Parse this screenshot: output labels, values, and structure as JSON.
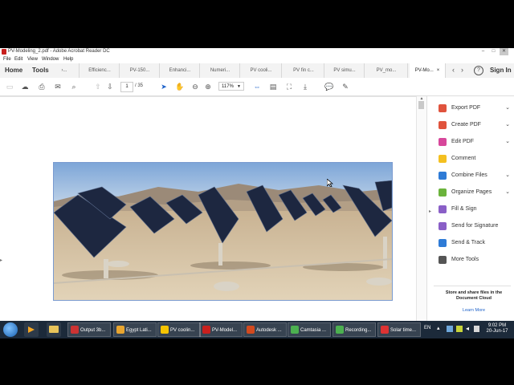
{
  "window": {
    "title": "PV-Modeling_2.pdf - Adobe Acrobat Reader DC",
    "controls": [
      "–",
      "□",
      "✕"
    ]
  },
  "menu": [
    "File",
    "Edit",
    "View",
    "Window",
    "Help"
  ],
  "nav": {
    "home": "Home",
    "tools": "Tools"
  },
  "tabs": [
    {
      "label": "›..."
    },
    {
      "label": "Efficienc..."
    },
    {
      "label": "PV-150..."
    },
    {
      "label": "Enhanci..."
    },
    {
      "label": "Numeri..."
    },
    {
      "label": "PV cooli..."
    },
    {
      "label": "PV fin c..."
    },
    {
      "label": "PV simu..."
    },
    {
      "label": "PV_mo..."
    },
    {
      "label": "PV-Mo...",
      "active": true
    }
  ],
  "tab_close": "×",
  "sign_in": "Sign In",
  "help_icon": "?",
  "toolbar": {
    "page_current": "1",
    "page_total": "/ 35",
    "zoom": "117%"
  },
  "right_panel": {
    "items": [
      {
        "label": "Export PDF",
        "color": "#e0533d",
        "chevron": true
      },
      {
        "label": "Create PDF",
        "color": "#e0533d",
        "chevron": true
      },
      {
        "label": "Edit PDF",
        "color": "#d7479b",
        "chevron": true
      },
      {
        "label": "Comment",
        "color": "#f4c020",
        "chevron": false
      },
      {
        "label": "Combine Files",
        "color": "#2e7bd6",
        "chevron": true
      },
      {
        "label": "Organize Pages",
        "color": "#6bb33c",
        "chevron": true
      },
      {
        "label": "Fill & Sign",
        "color": "#8a5fc7",
        "chevron": false
      },
      {
        "label": "Send for Signature",
        "color": "#8a5fc7",
        "chevron": false
      },
      {
        "label": "Send & Track",
        "color": "#2e7bd6",
        "chevron": false
      },
      {
        "label": "More Tools",
        "color": "#555555",
        "chevron": false
      }
    ],
    "cloud_text": "Store and share files in the Document Cloud",
    "learn_more": "Learn More"
  },
  "taskbar": {
    "items": [
      {
        "label": "Output 3b...",
        "color": "#c33"
      },
      {
        "label": "Egypt Lati...",
        "color": "#e8a530"
      },
      {
        "label": "PV coolin...",
        "color": "#f5c400"
      },
      {
        "label": "PV-Model...",
        "color": "#c8201e"
      },
      {
        "label": "Autodesk ...",
        "color": "#d24a1f"
      },
      {
        "label": "Camtasia ...",
        "color": "#4cb050"
      },
      {
        "label": "Recording...",
        "color": "#4cb050"
      },
      {
        "label": "Solar time...",
        "color": "#d33"
      }
    ],
    "lang": "EN",
    "time": "9:02 PM",
    "date": "20-Jun-17"
  }
}
